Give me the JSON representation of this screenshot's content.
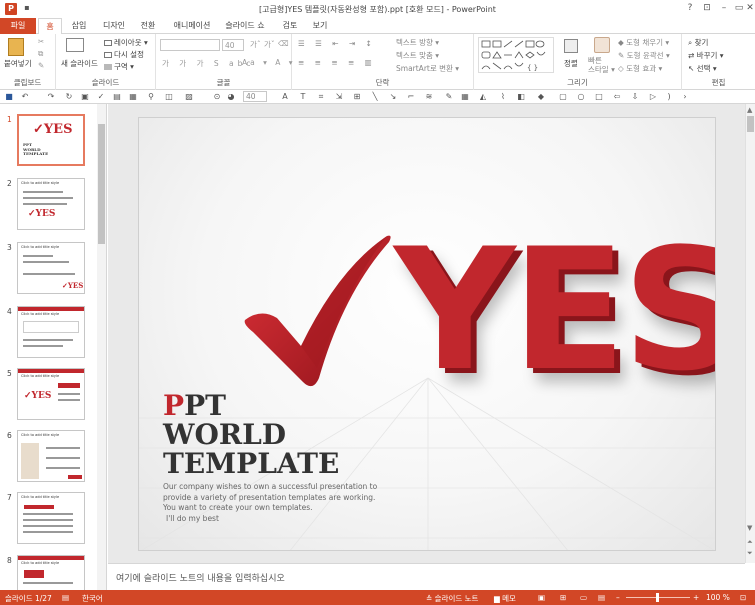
{
  "window": {
    "title": "[고급형]YES 템플릿(자동완성형 포함).ppt [호환 모드] - PowerPoint"
  },
  "tabs": [
    "파일",
    "홈",
    "삽입",
    "디자인",
    "전환",
    "애니메이션",
    "슬라이드 쇼",
    "검토",
    "보기"
  ],
  "ribbon": {
    "clipboard": {
      "paste": "붙여넣기",
      "label": "클립보드"
    },
    "slides": {
      "new_slide": "새 슬라이드",
      "layout": "레이아웃 ▾",
      "reset": "다시 설정",
      "section": "구역 ▾",
      "label": "슬라이드"
    },
    "font": {
      "size": "40",
      "label": "글꼴"
    },
    "paragraph": {
      "text_direction": "텍스트 방향 ▾",
      "align_text": "텍스트 맞춤 ▾",
      "smartart": "SmartArt로 변환 ▾",
      "label": "단락"
    },
    "drawing": {
      "arrange": "정렬",
      "quick_styles": "빠른\n스타일 ▾",
      "shape_fill": "도형 채우기 ▾",
      "shape_outline": "도형 윤곽선 ▾",
      "shape_effects": "도형 효과 ▾",
      "label": "그리기"
    },
    "editing": {
      "find": "찾기",
      "replace": "바꾸기 ▾",
      "select": "선택 ▾",
      "label": "편집"
    }
  },
  "qat": {
    "font_size": "40"
  },
  "thumbnails": [
    {
      "num": "1",
      "kind": "title"
    },
    {
      "num": "2",
      "kind": "content"
    },
    {
      "num": "3",
      "kind": "content"
    },
    {
      "num": "4",
      "kind": "content"
    },
    {
      "num": "5",
      "kind": "content"
    },
    {
      "num": "6",
      "kind": "content"
    },
    {
      "num": "7",
      "kind": "content"
    },
    {
      "num": "8",
      "kind": "content"
    }
  ],
  "thumb_labels": {
    "title_yes": "✓YES",
    "title_text": "PPT\nWORLD\nTEMPLATE",
    "content_heading": "Click to add title style"
  },
  "slide": {
    "big_text": "YES",
    "title_line1_first": "P",
    "title_line1_rest": "PT",
    "title_line2": "WORLD",
    "title_line3": "TEMPLATE",
    "desc1": "Our company wishes to own a successful presentation to",
    "desc2": "provide a variety of presentation templates are working.",
    "desc3": "You want to create your own templates.",
    "desc4": "I'll do my best"
  },
  "notes": {
    "placeholder": "여기에 슬라이드 노트의 내용을 입력하십시오"
  },
  "statusbar": {
    "slide_count": "슬라이드 1/27",
    "language": "한국어",
    "notes": "슬라이드 노트",
    "comments": "메모",
    "zoom": "100 %"
  },
  "colors": {
    "accent": "#d24726",
    "yes_red": "#c1272d"
  }
}
